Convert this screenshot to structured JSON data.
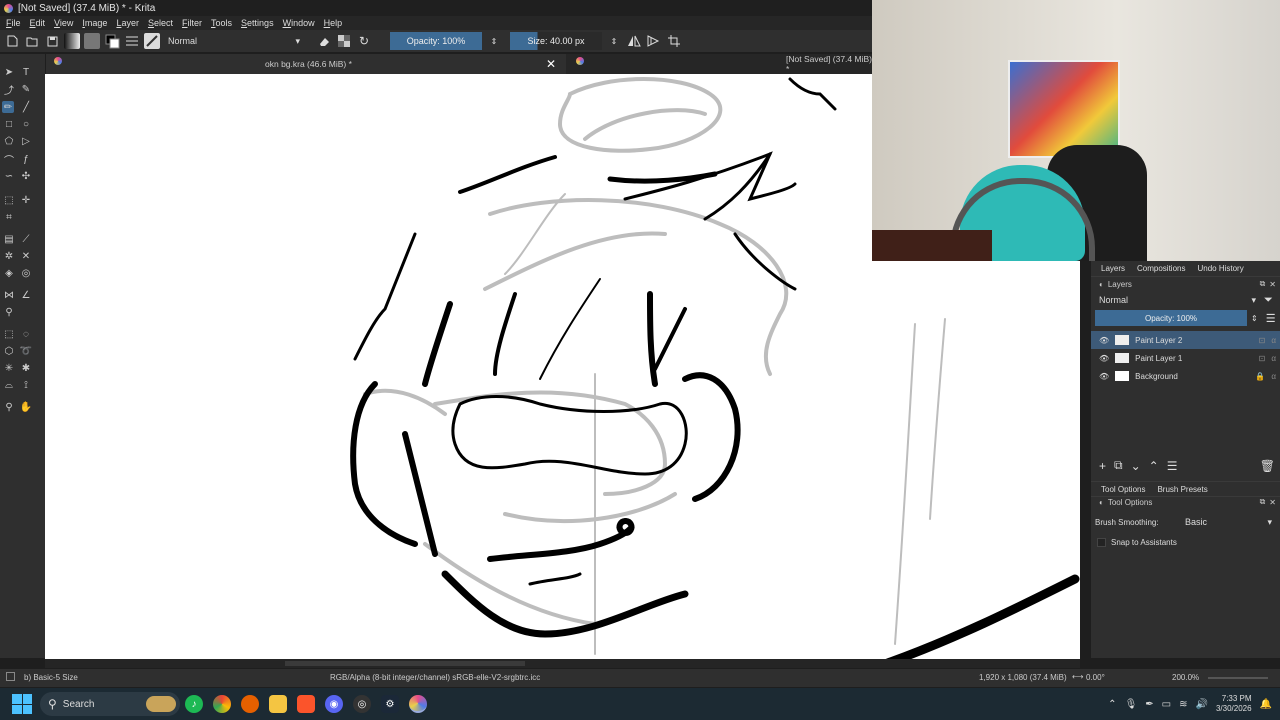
{
  "window": {
    "title": "[Not Saved]  (37.4 MiB) * - Krita"
  },
  "menu": {
    "items": [
      "File",
      "Edit",
      "View",
      "Image",
      "Layer",
      "Select",
      "Filter",
      "Tools",
      "Settings",
      "Window",
      "Help"
    ]
  },
  "toolbar": {
    "blend_mode": "Normal",
    "opacity_label": "Opacity: 100%",
    "size_label": "Size: 40.00 px",
    "opacity_value": 1.0
  },
  "tabs": [
    {
      "label": "okn bg.kra (46.6 MiB) *"
    },
    {
      "label": "[Not Saved]  (37.4 MiB) *"
    }
  ],
  "docker": {
    "tabs": [
      "Layers",
      "Compositions",
      "Undo History"
    ],
    "panel_title": "Layers",
    "blend_mode": "Normal",
    "opacity_label": "Opacity:  100%",
    "layers": [
      {
        "name": "Paint Layer 2",
        "selected": true
      },
      {
        "name": "Paint Layer 1",
        "selected": false
      },
      {
        "name": "Background",
        "selected": false
      }
    ],
    "tool_tabs": [
      "Tool Options",
      "Brush Presets"
    ],
    "tool_options_title": "Tool Options",
    "smoothing_label": "Brush Smoothing:",
    "smoothing_value": "Basic",
    "snap_label": "Snap to Assistants"
  },
  "status": {
    "brush": "b) Basic-5 Size",
    "color_profile": "RGB/Alpha (8-bit integer/channel)  sRGB-elle-V2-srgbtrc.icc",
    "dimensions": "1,920 x 1,080 (37.4 MiB)",
    "rotation": "0.00°",
    "zoom": "200.0%"
  },
  "taskbar": {
    "search_label": "Search",
    "time": "7:33 PM",
    "date": "3/30/2026"
  },
  "colors": {
    "accent": "#3d6b95",
    "panel": "#2f2f2f",
    "selected_layer": "#3d5a78"
  }
}
